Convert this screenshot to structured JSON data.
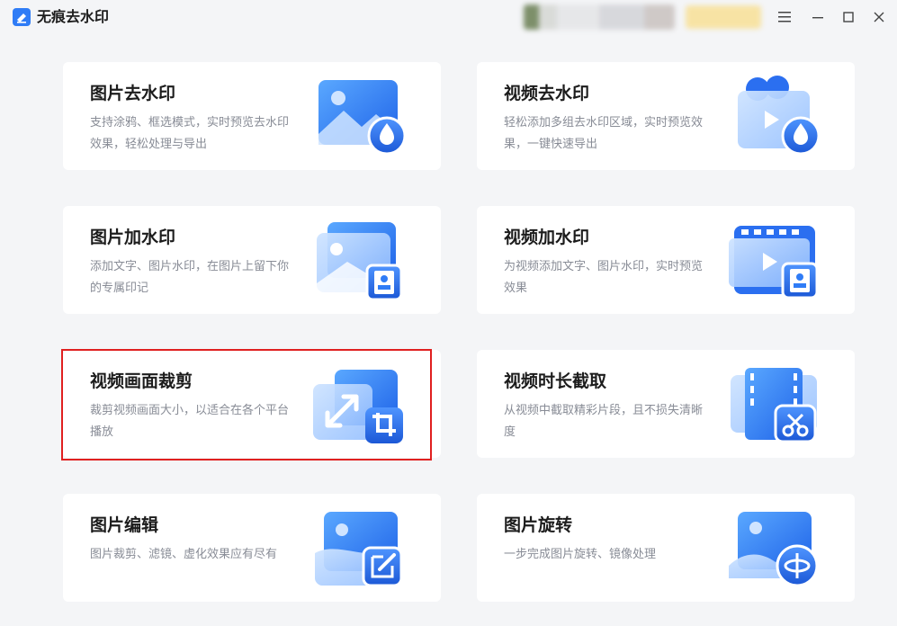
{
  "app": {
    "title": "无痕去水印"
  },
  "window_controls": [
    "menu-icon",
    "minimize-icon",
    "maximize-icon",
    "close-icon"
  ],
  "colors": {
    "accent": "#2f7cf6",
    "highlight_border": "#e02020"
  },
  "cards": [
    {
      "title": "图片去水印",
      "desc": "支持涂鸦、框选模式，实时预览去水印效果，轻松处理与导出",
      "icon": "image-remove-watermark-icon"
    },
    {
      "title": "视频去水印",
      "desc": "轻松添加多组去水印区域，实时预览效果，一键快速导出",
      "icon": "video-remove-watermark-icon"
    },
    {
      "title": "图片加水印",
      "desc": "添加文字、图片水印，在图片上留下你的专属印记",
      "icon": "image-add-watermark-icon"
    },
    {
      "title": "视频加水印",
      "desc": "为视频添加文字、图片水印，实时预览效果",
      "icon": "video-add-watermark-icon"
    },
    {
      "title": "视频画面裁剪",
      "desc": "裁剪视频画面大小，以适合在各个平台播放",
      "icon": "video-crop-icon"
    },
    {
      "title": "视频时长截取",
      "desc": "从视频中截取精彩片段，且不损失清晰度",
      "icon": "video-trim-icon"
    },
    {
      "title": "图片编辑",
      "desc": "图片裁剪、滤镜、虚化效果应有尽有",
      "icon": "image-edit-icon"
    },
    {
      "title": "图片旋转",
      "desc": "一步完成图片旋转、镜像处理",
      "icon": "image-rotate-icon"
    }
  ]
}
